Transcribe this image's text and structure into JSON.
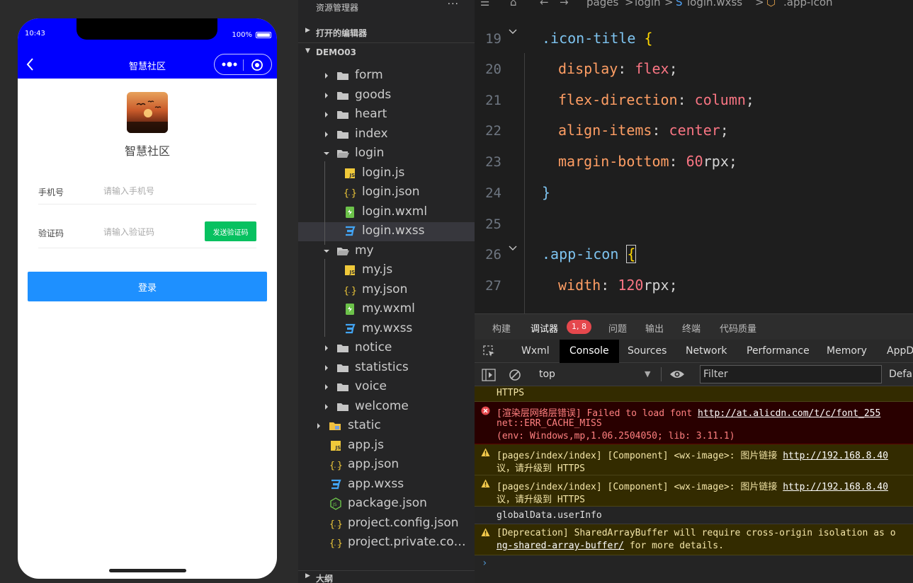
{
  "simulator": {
    "status_time": "10:43",
    "battery": "100%",
    "nav_title": "智慧社区",
    "app_title": "智慧社区",
    "phone_label": "手机号",
    "phone_placeholder": "请输入手机号",
    "code_label": "验证码",
    "code_placeholder": "请输入验证码",
    "send_code": "发送验证码",
    "login": "登录",
    "nav_color": "#0000ff",
    "send_code_color": "#07c160",
    "login_color": "#1e90ff"
  },
  "explorer": {
    "title": "资源管理器",
    "more": "···",
    "open_editors": "打开的编辑器",
    "project": "DEMO03",
    "outline": "大纲",
    "items": [
      {
        "label": "form",
        "type": "folder",
        "icon": "folder-icon"
      },
      {
        "label": "goods",
        "type": "folder",
        "icon": "folder-icon"
      },
      {
        "label": "heart",
        "type": "folder",
        "icon": "folder-icon"
      },
      {
        "label": "index",
        "type": "folder",
        "icon": "folder-icon"
      },
      {
        "label": "login",
        "type": "folder-open",
        "icon": "folder-open-icon"
      },
      {
        "label": "login.js",
        "type": "js",
        "icon": "js-file-icon"
      },
      {
        "label": "login.json",
        "type": "json",
        "icon": "json-file-icon"
      },
      {
        "label": "login.wxml",
        "type": "wxml",
        "icon": "wxml-file-icon"
      },
      {
        "label": "login.wxss",
        "type": "wxss",
        "icon": "wxss-file-icon"
      },
      {
        "label": "my",
        "type": "folder-open",
        "icon": "folder-open-icon"
      },
      {
        "label": "my.js",
        "type": "js",
        "icon": "js-file-icon"
      },
      {
        "label": "my.json",
        "type": "json",
        "icon": "json-file-icon"
      },
      {
        "label": "my.wxml",
        "type": "wxml",
        "icon": "wxml-file-icon"
      },
      {
        "label": "my.wxss",
        "type": "wxss",
        "icon": "wxss-file-icon"
      },
      {
        "label": "notice",
        "type": "folder",
        "icon": "folder-icon"
      },
      {
        "label": "statistics",
        "type": "folder",
        "icon": "folder-icon"
      },
      {
        "label": "voice",
        "type": "folder",
        "icon": "folder-icon"
      },
      {
        "label": "welcome",
        "type": "folder",
        "icon": "folder-icon"
      },
      {
        "label": "static",
        "type": "folder-static",
        "icon": "static-folder-icon"
      },
      {
        "label": "app.js",
        "type": "js",
        "icon": "js-file-icon"
      },
      {
        "label": "app.json",
        "type": "json",
        "icon": "json-file-icon"
      },
      {
        "label": "app.wxss",
        "type": "wxss",
        "icon": "wxss-file-icon"
      },
      {
        "label": "package.json",
        "type": "node",
        "icon": "nodejs-file-icon"
      },
      {
        "label": "project.config.json",
        "type": "json",
        "icon": "json-file-icon"
      },
      {
        "label": "project.private.config...",
        "type": "json",
        "icon": "json-file-icon"
      }
    ]
  },
  "editor": {
    "breadcrumb": [
      "pages",
      ">",
      "login",
      ">",
      "login.wxss",
      ">",
      ".app-icon"
    ],
    "line_numbers": [
      "19",
      "20",
      "21",
      "22",
      "23",
      "24",
      "25",
      "26",
      "27"
    ],
    "code": {
      "l19_sel": ".icon-title",
      "l19_brace": "{",
      "l20_prop": "display",
      "l20_val": "flex",
      "l21_prop": "flex-direction",
      "l21_val": "column",
      "l22_prop": "align-items",
      "l22_val": "center",
      "l23_prop": "margin-bottom",
      "l23_num": "60",
      "l23_unit": "rpx",
      "l24_brace": "}",
      "l26_sel": ".app-icon",
      "l26_brace": "{",
      "l27_prop": "width",
      "l27_num": "120",
      "l27_unit": "rpx"
    },
    "punct": {
      "colon": ":",
      "semi": ";",
      "space": " "
    }
  },
  "debugger": {
    "tabs": [
      "构建",
      "调试器",
      "问题",
      "输出",
      "终端",
      "代码质量"
    ],
    "badge": "1, 8",
    "devtools_tabs": [
      "Wxml",
      "Console",
      "Sources",
      "Network",
      "Performance",
      "Memory",
      "AppD"
    ],
    "context": "top",
    "filter_placeholder": "Filter",
    "levels": "Defau",
    "messages": {
      "m0": "HTTPS",
      "m1_a": "[渲染层网络层错误] Failed to load font ",
      "m1_link": "http://at.alicdn.com/t/c/font_255",
      "m1_b": "net::ERR_CACHE_MISS",
      "m1_c": "(env: Windows,mp,1.06.2504050; lib: 3.11.1)",
      "m2_a": "[pages/index/index] [Component] <wx-image>: 图片链接 ",
      "m2_link": "http://192.168.8.40",
      "m2_b": "议，请升级到 HTTPS",
      "m3_a": "[pages/index/index] [Component] <wx-image>: 图片链接 ",
      "m3_link": "http://192.168.8.40",
      "m3_b": "议，请升级到 HTTPS",
      "m4": "globalData.userInfo",
      "m5_a": "[Deprecation] SharedArrayBuffer will require cross-origin isolation as o",
      "m5_link": "ng-shared-array-buffer/",
      "m5_b": " for more details."
    },
    "prompt": "›"
  }
}
